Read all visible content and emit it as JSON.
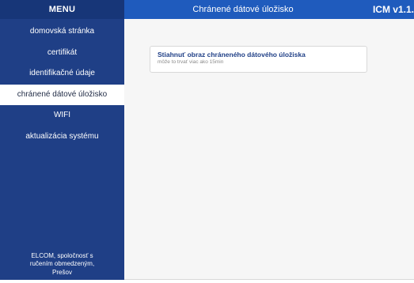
{
  "sidebar": {
    "header": "MENU",
    "items": [
      {
        "label": "domovská stránka",
        "active": false
      },
      {
        "label": "certifikát",
        "active": false
      },
      {
        "label": "identifikačné údaje",
        "active": false
      },
      {
        "label": "chránené dátové úložisko",
        "active": true
      },
      {
        "label": "WIFI",
        "active": false
      },
      {
        "label": "aktualizácia systému",
        "active": false
      }
    ],
    "footer_lines": [
      "ELCOM, spoločnosť s",
      "ručením obmedzeným,",
      "Prešov"
    ]
  },
  "header": {
    "title": "Chránené dátové úložisko",
    "version": "ICM v1.1."
  },
  "main": {
    "card": {
      "title": "Stiahnuť obraz chráneného dátového úložiska",
      "subtitle": "môže to trvať viac ako 15min"
    }
  },
  "colors": {
    "sidebar_bg": "#1f3f86",
    "topbar_bg": "#1f5bbd",
    "content_bg": "#f6f6f6",
    "active_item_bg": "#ffffff"
  }
}
